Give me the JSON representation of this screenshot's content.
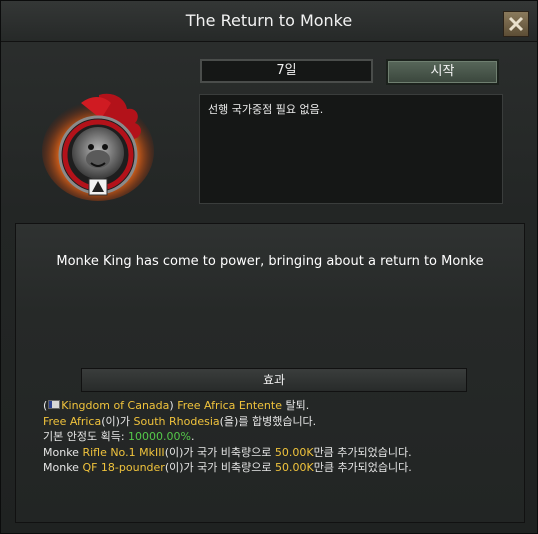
{
  "window": {
    "title": "The Return to Monke"
  },
  "header": {
    "days": "7일",
    "start_label": "시작",
    "prerequisite": "선행 국가중점 필요 없음."
  },
  "main": {
    "description": "Monke King has come to power, bringing about a return to Monke",
    "effects_header": "효과"
  },
  "effects": {
    "line1": {
      "open": "(",
      "country": "Kingdom of Canada",
      "close": ")",
      "faction": "Free Africa Entente",
      "suffix": " 탈퇴."
    },
    "line2": {
      "state": "Free Africa",
      "mid1": "(이)가 ",
      "target": "South Rhodesia",
      "mid2": "(을)를 합병했습니다."
    },
    "line3": {
      "prefix": "기본 안정도 획득: ",
      "value": "10000.00%",
      "suffix": "."
    },
    "line4": {
      "prefix": "Monke ",
      "item": "Rifle No.1 MkIII",
      "mid": "(이)가 국가 비축량으로 ",
      "amount": "50.00K",
      "suffix": "만큼 추가되었습니다."
    },
    "line5": {
      "prefix": "Monke ",
      "item": "QF 18-pounder",
      "mid": "(이)가 국가 비축량으로 ",
      "amount": "50.00K",
      "suffix": "만큼 추가되었습니다."
    }
  },
  "colors": {
    "highlight": "#f0c33c",
    "positive": "#54c84a",
    "start_button": "#4c5a4e"
  },
  "icons": {
    "close": "close-x-icon",
    "focus": "monke-focus-emblem-icon",
    "flag": "canada-flag-icon"
  }
}
